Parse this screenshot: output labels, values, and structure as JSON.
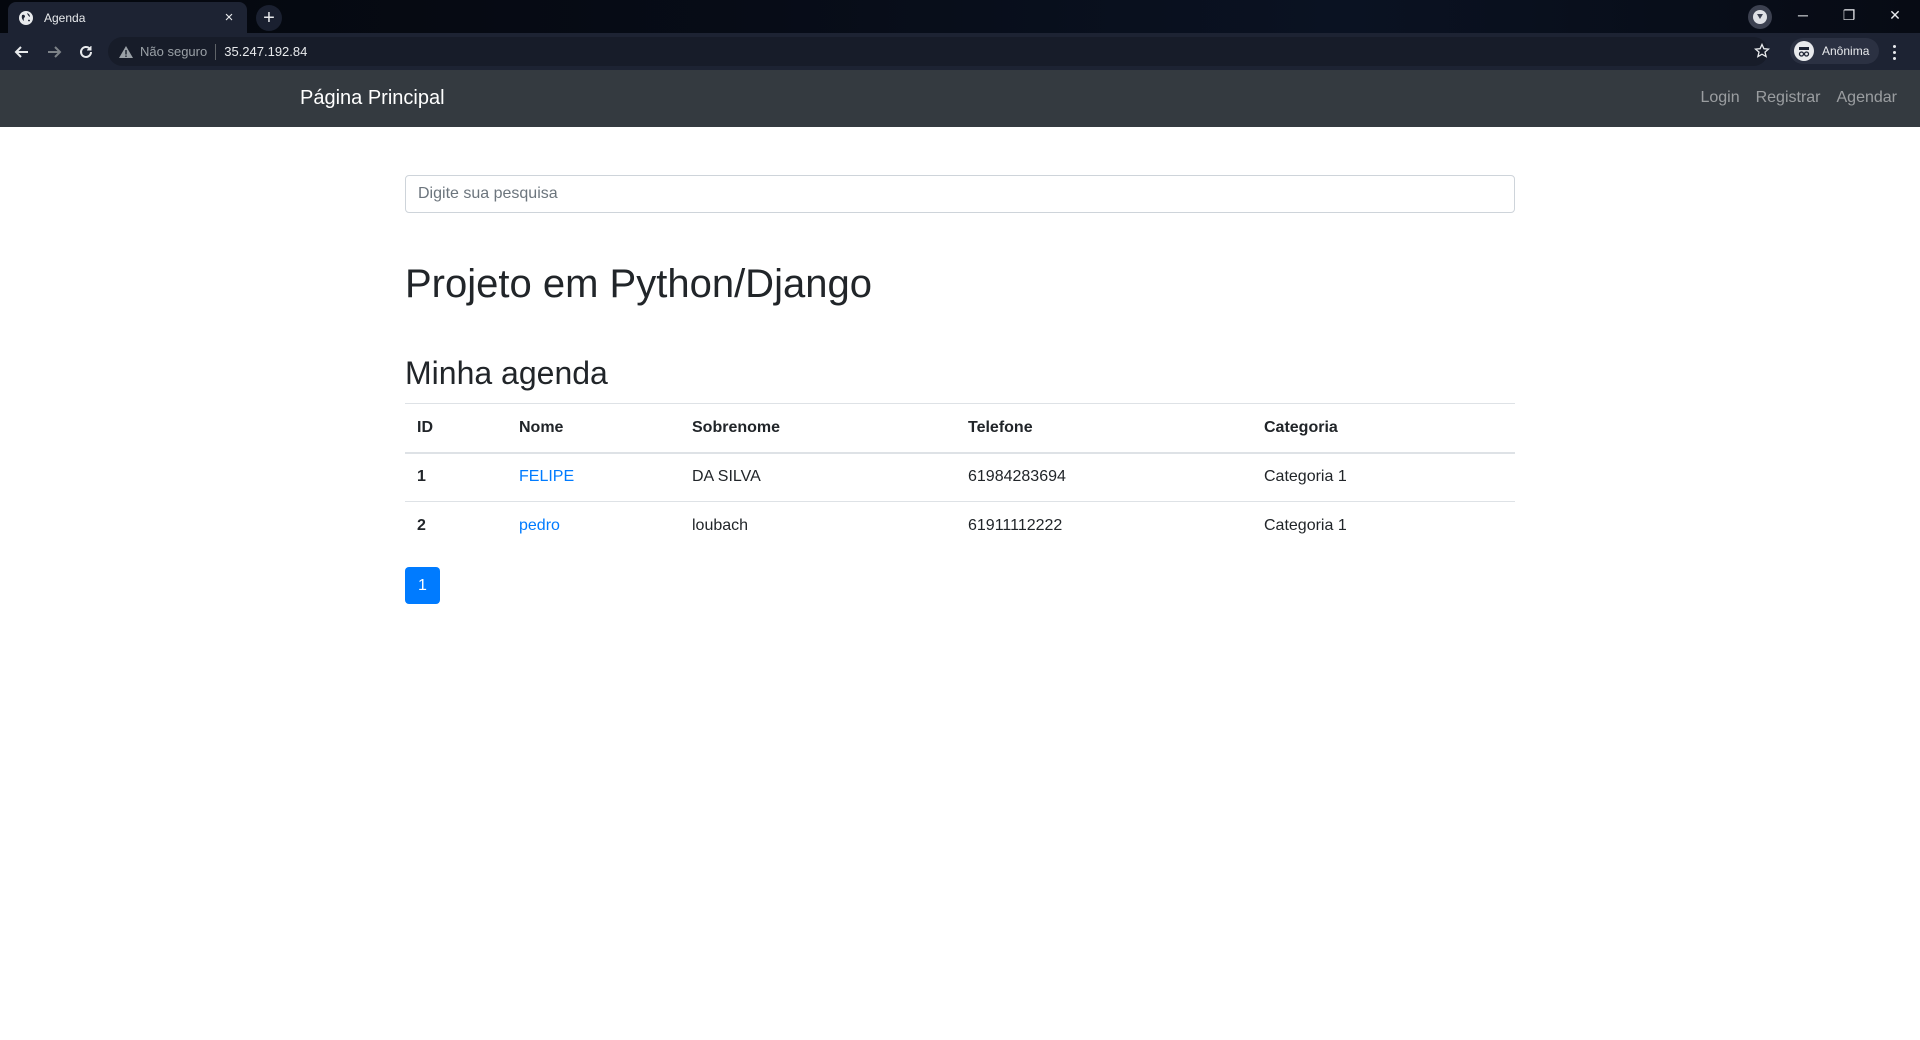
{
  "browser": {
    "tab_title": "Agenda",
    "tab_close": "×",
    "new_tab": "+",
    "security_label": "Não seguro",
    "url": "35.247.192.84",
    "profile_label": "Anônima",
    "window_controls": {
      "minimize": "─",
      "restore": "❐",
      "close": "✕"
    }
  },
  "navbar": {
    "brand": "Página Principal",
    "links": [
      "Login",
      "Registrar",
      "Agendar"
    ]
  },
  "search": {
    "placeholder": "Digite sua pesquisa",
    "value": ""
  },
  "main": {
    "title": "Projeto em Python/Django",
    "subtitle": "Minha agenda"
  },
  "table": {
    "columns": [
      "ID",
      "Nome",
      "Sobrenome",
      "Telefone",
      "Categoria"
    ],
    "rows": [
      {
        "id": "1",
        "nome": "FELIPE",
        "sobrenome": "DA SILVA",
        "telefone": "61984283694",
        "categoria": "Categoria 1"
      },
      {
        "id": "2",
        "nome": "pedro",
        "sobrenome": "loubach",
        "telefone": "61911112222",
        "categoria": "Categoria 1"
      }
    ]
  },
  "pagination": {
    "current": "1"
  },
  "colors": {
    "navbar_bg": "#343a40",
    "link": "#007bff",
    "pager_active": "#007bff"
  }
}
